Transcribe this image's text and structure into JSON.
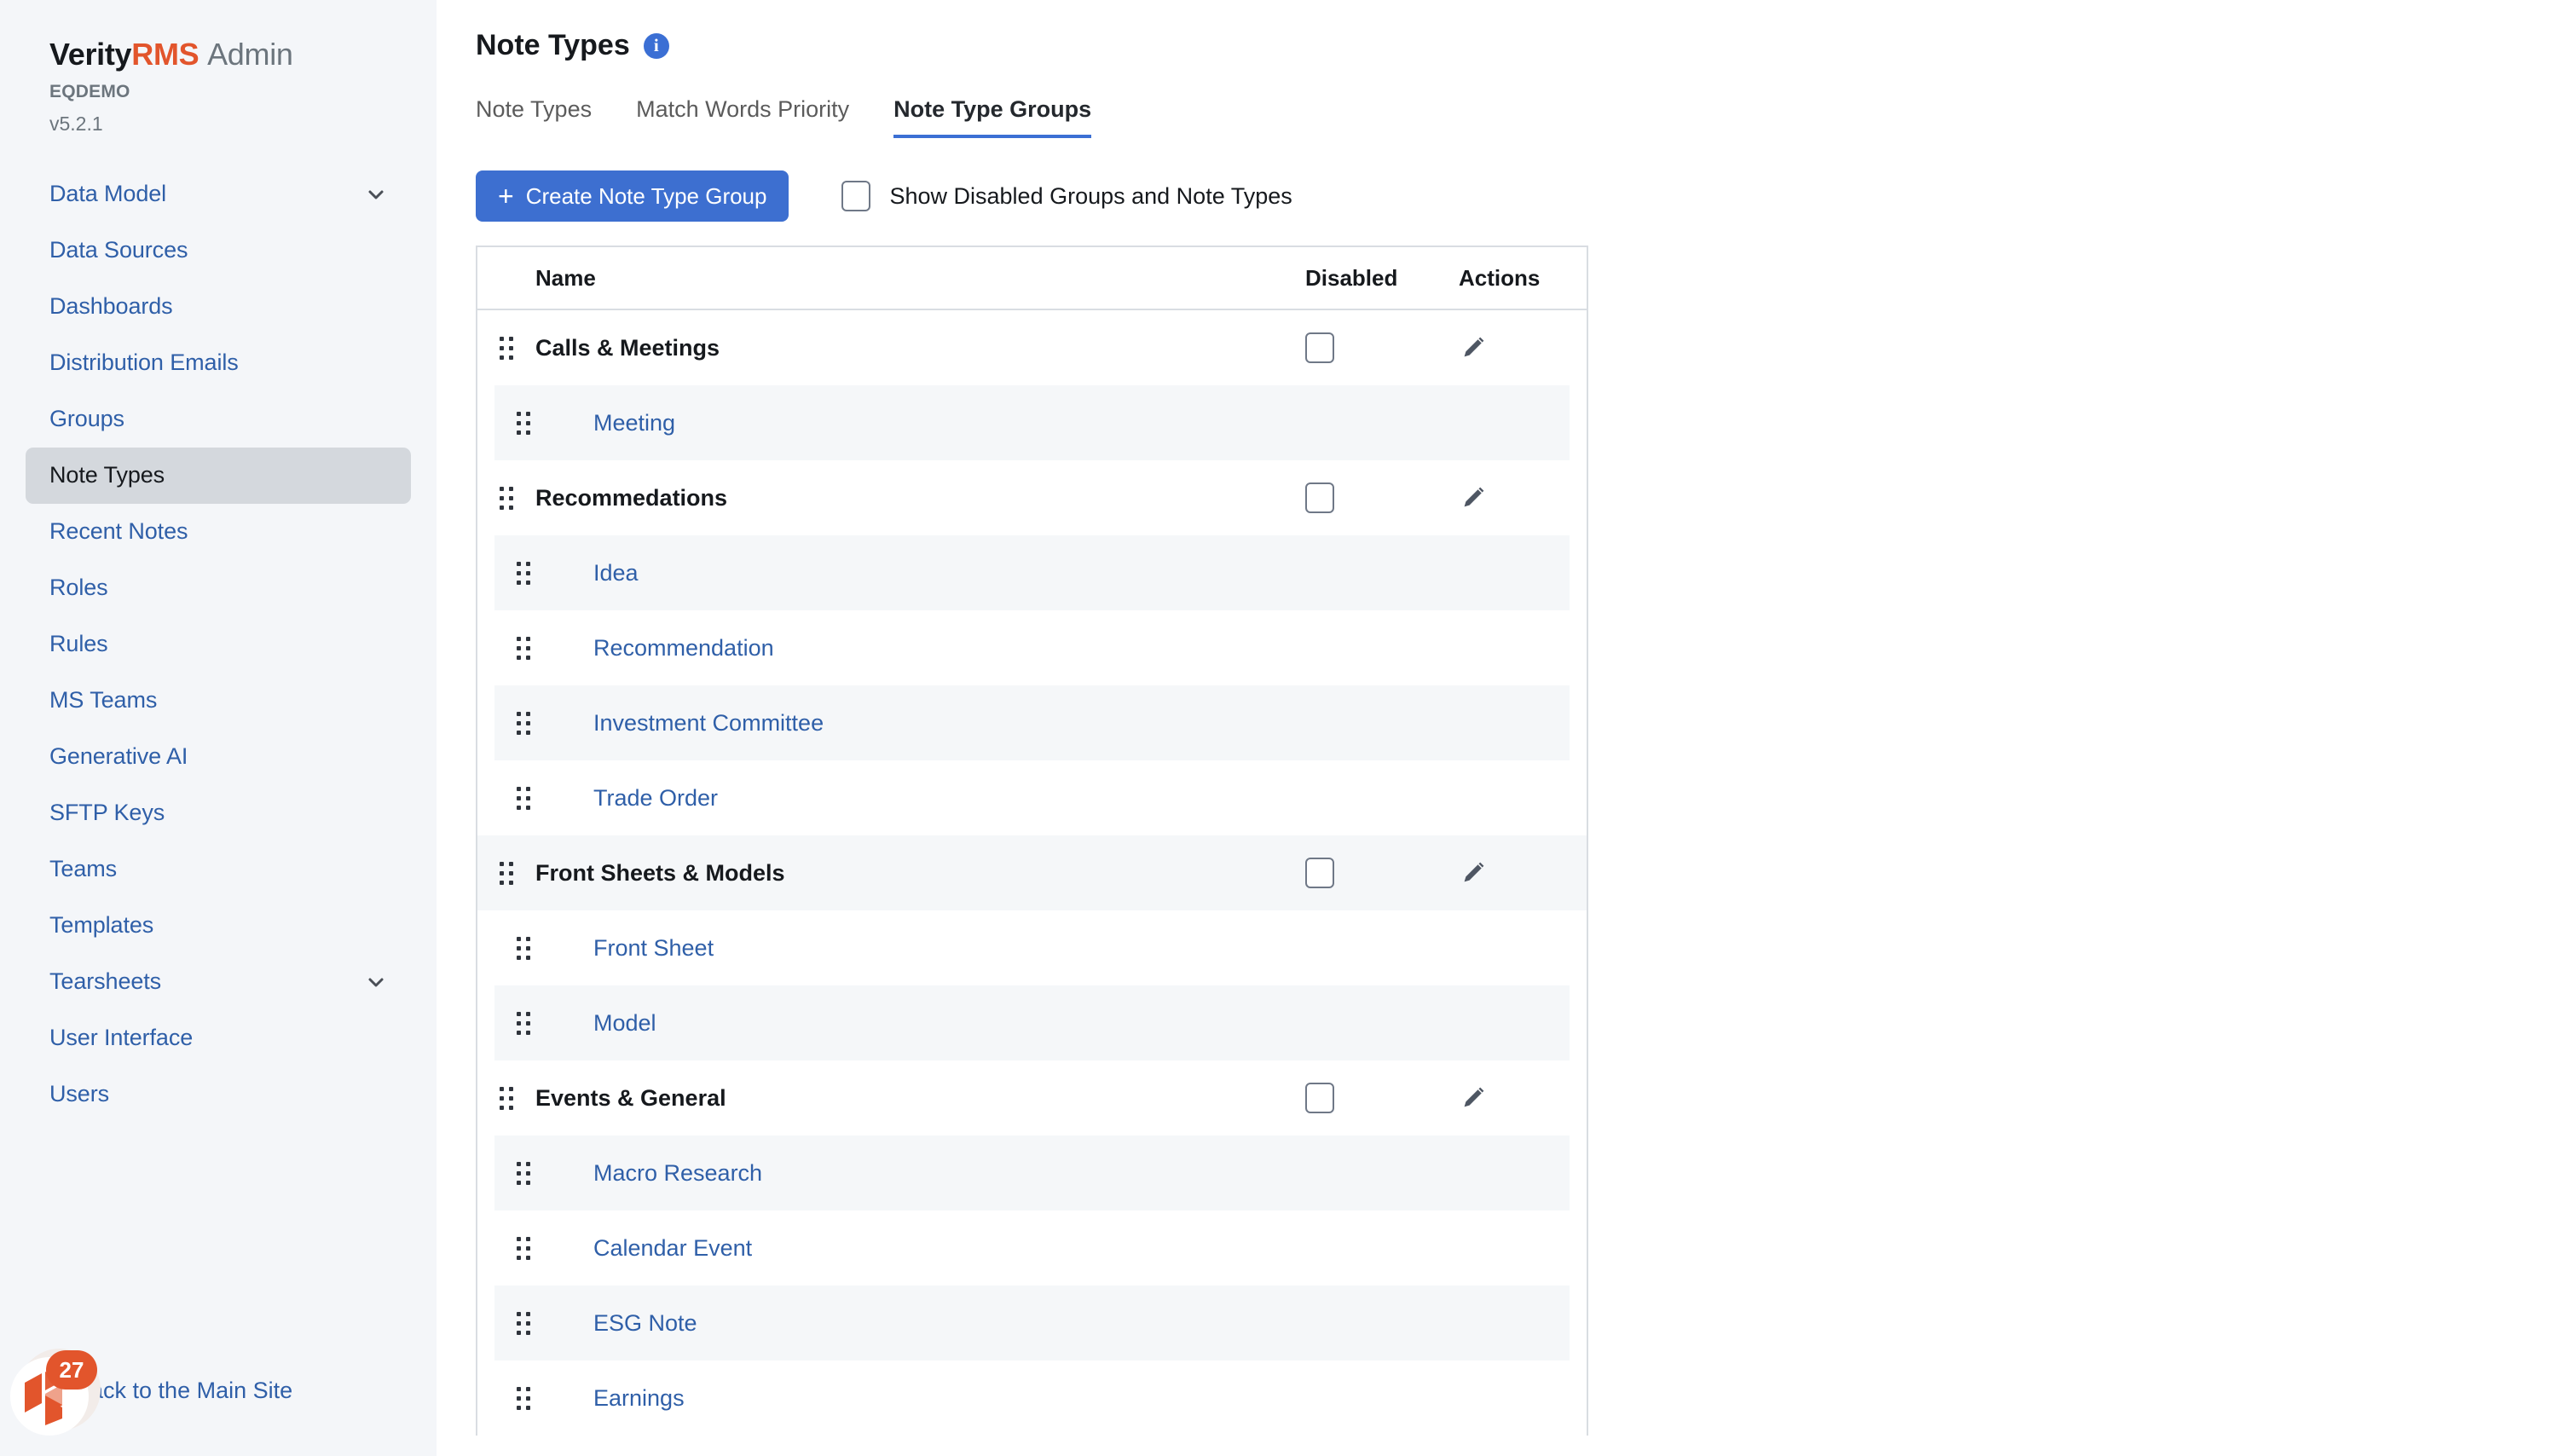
{
  "brand": {
    "name_primary": "Verity",
    "name_accent": "RMS",
    "name_suffix": "Admin",
    "environment": "EQDEMO",
    "version": "v5.2.1",
    "accent_color": "#e2552c"
  },
  "sidebar": {
    "items": [
      {
        "label": "Data Model",
        "expandable": true,
        "active": false
      },
      {
        "label": "Data Sources",
        "expandable": false,
        "active": false
      },
      {
        "label": "Dashboards",
        "expandable": false,
        "active": false
      },
      {
        "label": "Distribution Emails",
        "expandable": false,
        "active": false
      },
      {
        "label": "Groups",
        "expandable": false,
        "active": false
      },
      {
        "label": "Note Types",
        "expandable": false,
        "active": true
      },
      {
        "label": "Recent Notes",
        "expandable": false,
        "active": false
      },
      {
        "label": "Roles",
        "expandable": false,
        "active": false
      },
      {
        "label": "Rules",
        "expandable": false,
        "active": false
      },
      {
        "label": "MS Teams",
        "expandable": false,
        "active": false
      },
      {
        "label": "Generative AI",
        "expandable": false,
        "active": false
      },
      {
        "label": "SFTP Keys",
        "expandable": false,
        "active": false
      },
      {
        "label": "Teams",
        "expandable": false,
        "active": false
      },
      {
        "label": "Templates",
        "expandable": false,
        "active": false
      },
      {
        "label": "Tearsheets",
        "expandable": true,
        "active": false
      },
      {
        "label": "User Interface",
        "expandable": false,
        "active": false
      },
      {
        "label": "Users",
        "expandable": false,
        "active": false
      }
    ],
    "back_link": "Back to the Main Site",
    "launcher_badge": "27"
  },
  "header": {
    "title": "Note Types"
  },
  "tabs": [
    {
      "label": "Note Types",
      "active": false
    },
    {
      "label": "Match Words Priority",
      "active": false
    },
    {
      "label": "Note Type Groups",
      "active": true
    }
  ],
  "toolbar": {
    "create_label": "Create Note Type Group",
    "plus_glyph": "+",
    "show_disabled_label": "Show Disabled Groups and Note Types",
    "show_disabled_checked": false,
    "button_color": "#3d6fd0"
  },
  "table": {
    "columns": {
      "name": "Name",
      "disabled": "Disabled",
      "actions": "Actions"
    },
    "rows": [
      {
        "type": "group",
        "name": "Calls & Meetings",
        "disabled": false
      },
      {
        "type": "child",
        "name": "Meeting"
      },
      {
        "type": "group",
        "name": "Recommedations",
        "disabled": false
      },
      {
        "type": "child",
        "name": "Idea"
      },
      {
        "type": "child",
        "name": "Recommendation"
      },
      {
        "type": "child",
        "name": "Investment Committee"
      },
      {
        "type": "child",
        "name": "Trade Order"
      },
      {
        "type": "group",
        "name": "Front Sheets & Models",
        "disabled": false
      },
      {
        "type": "child",
        "name": "Front Sheet"
      },
      {
        "type": "child",
        "name": "Model"
      },
      {
        "type": "group",
        "name": "Events & General",
        "disabled": false
      },
      {
        "type": "child",
        "name": "Macro Research"
      },
      {
        "type": "child",
        "name": "Calendar Event"
      },
      {
        "type": "child",
        "name": "ESG Note"
      },
      {
        "type": "child",
        "name": "Earnings"
      }
    ]
  }
}
